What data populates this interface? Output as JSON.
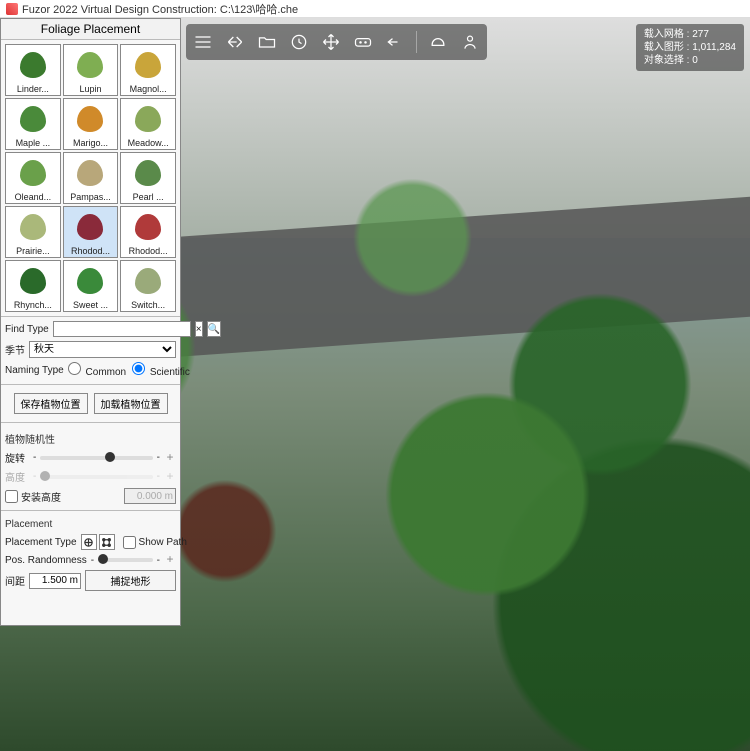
{
  "titlebar": {
    "text": "Fuzor 2022 Virtual Design Construction: C:\\123\\哈哈.che"
  },
  "stats": {
    "row1_label": "载入网格 :",
    "row1_value": "277",
    "row2_label": "载入图形 :",
    "row2_value": "1,011,284",
    "row3_label": "对象选择 :",
    "row3_value": "0"
  },
  "panel": {
    "title": "Foliage Placement",
    "items": [
      {
        "label": "Linder...",
        "c": "#3b7a2e"
      },
      {
        "label": "Lupin",
        "c": "#7fae52"
      },
      {
        "label": "Magnol...",
        "c": "#c9a53a"
      },
      {
        "label": "Maple ...",
        "c": "#4a8a3a"
      },
      {
        "label": "Marigo...",
        "c": "#d08a2a"
      },
      {
        "label": "Meadow...",
        "c": "#8aa85a"
      },
      {
        "label": "Oleand...",
        "c": "#6aa04a"
      },
      {
        "label": "Pampas...",
        "c": "#b8a77a"
      },
      {
        "label": "Pearl ...",
        "c": "#5a8a4a"
      },
      {
        "label": "Prairie...",
        "c": "#aab87a"
      },
      {
        "label": "Rhodod...",
        "c": "#8a2a3a",
        "sel": true
      },
      {
        "label": "Rhodod...",
        "c": "#b03a3a"
      },
      {
        "label": "Rhynch...",
        "c": "#2a6a2a"
      },
      {
        "label": "Sweet ...",
        "c": "#3a8a3a"
      },
      {
        "label": "Switch...",
        "c": "#9aaa7a"
      }
    ],
    "find_label": "Find Type",
    "season_label": "季节",
    "season_value": "秋天",
    "naming_label": "Naming Type",
    "naming_common": "Common",
    "naming_scientific": "Scientific",
    "btn_save": "保存植物位置",
    "btn_load": "加载植物位置",
    "random_title": "植物随机性",
    "rotate_label": "旋转",
    "height_label": "高度",
    "install_height_label": "安装高度",
    "install_height_value": "0.000 m",
    "placement_title": "Placement",
    "placement_type_label": "Placement Type",
    "show_path_label": "Show Path",
    "pos_random_label": "Pos. Randomness",
    "spacing_label": "间距",
    "spacing_value": "1.500 m",
    "terrain_btn": "捕捉地形"
  }
}
